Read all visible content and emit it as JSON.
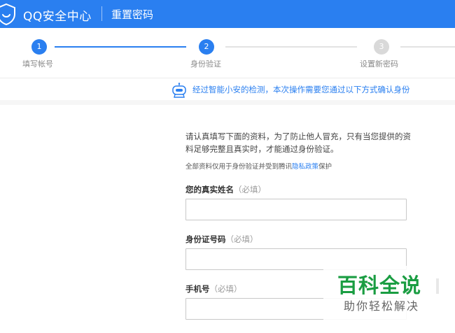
{
  "header": {
    "logo_icon": "shield-icon",
    "brand": "QQ安全中心",
    "title": "重置密码",
    "color": "#2a7ff0"
  },
  "steps": [
    {
      "number": "1",
      "label": "填写帐号",
      "state": "done"
    },
    {
      "number": "2",
      "label": "身份验证",
      "state": "current"
    },
    {
      "number": "3",
      "label": "设置新密码",
      "state": "pending"
    }
  ],
  "notice": {
    "icon": "robot-icon",
    "text": "经过智能小安的检测，本次操作需要您通过以下方式确认身份"
  },
  "form": {
    "intro": "请认真填写下面的资料，为了防止他人冒充，只有当您提供的资料足够完整且真实时，才能通过身份验证。",
    "privacy_prefix": "全部资料仅用于身份验证并受到腾讯",
    "privacy_link": "隐私政策",
    "privacy_suffix": "保护",
    "fields": [
      {
        "label": "您的真实姓名",
        "note": "（必填）",
        "value": ""
      },
      {
        "label": "身份证号码",
        "note": "（必填）",
        "value": ""
      },
      {
        "label": "手机号",
        "note": "（必填）",
        "value": ""
      }
    ]
  },
  "watermark": {
    "title": "百科全说",
    "subtitle": "助你轻松解决"
  }
}
